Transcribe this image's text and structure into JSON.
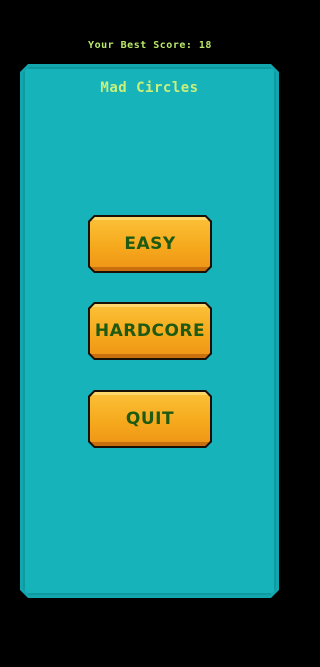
{
  "header": {
    "best_score_label": "Your Best Score: 18"
  },
  "panel": {
    "title": "Mad Circles"
  },
  "menu": {
    "easy_label": "EASY",
    "hardcore_label": "HARDCORE",
    "quit_label": "QUIT"
  },
  "colors": {
    "background": "#000000",
    "panel": "#16b3ba",
    "title_text": "#c8f07a",
    "score_text": "#b9e86a",
    "button_face": "#f6a91c",
    "button_text": "#1f5a12"
  }
}
